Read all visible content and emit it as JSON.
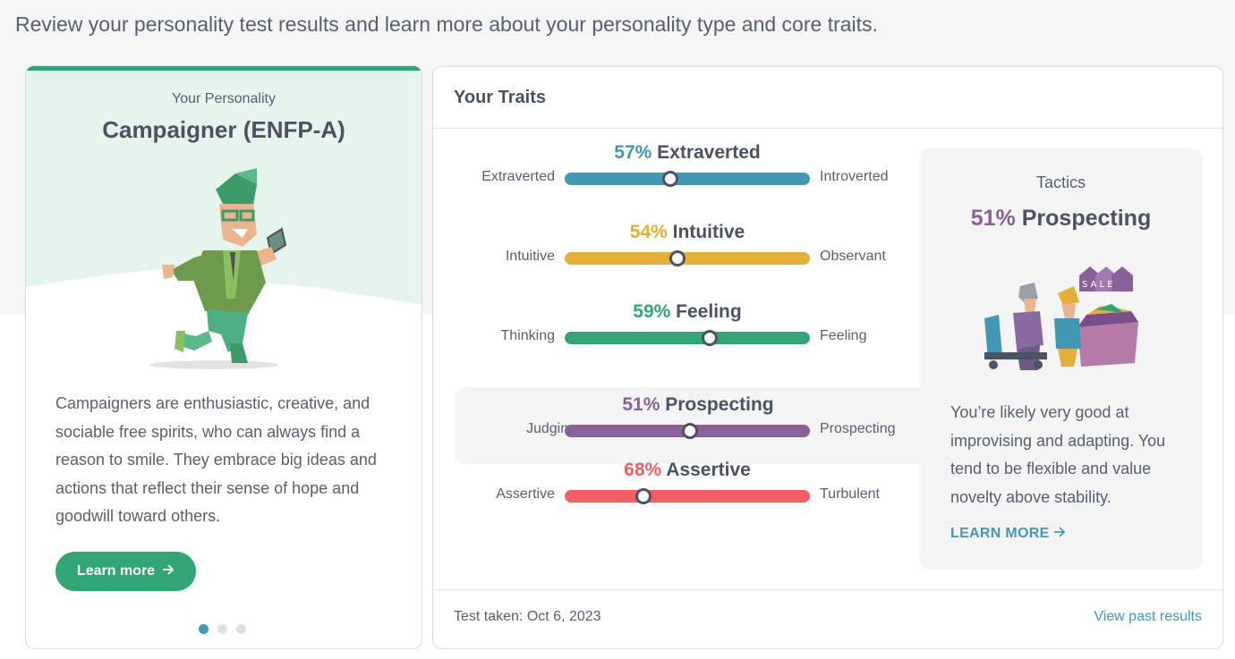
{
  "intro_text": "Review your personality test results and learn more about your personality type and core traits.",
  "personality_card": {
    "label": "Your Personality",
    "type_name": "Campaigner (ENFP-A)",
    "description": "Campaigners are enthusiastic, creative, and sociable free spirits, who can always find a reason to smile. They embrace big ideas and actions that reflect their sense of hope and goodwill toward others.",
    "button_label": "Learn more",
    "carousel": {
      "count": 3,
      "active": 0
    },
    "accent": "#33a474"
  },
  "traits_card": {
    "title": "Your Traits",
    "traits": [
      {
        "percent": "57%",
        "name": "Extraverted",
        "left": "Extraverted",
        "right": "Introverted",
        "position": 0.43,
        "color": "#4298b4",
        "highlighted": false
      },
      {
        "percent": "54%",
        "name": "Intuitive",
        "left": "Intuitive",
        "right": "Observant",
        "position": 0.46,
        "color": "#e4ae3a",
        "highlighted": false
      },
      {
        "percent": "59%",
        "name": "Feeling",
        "left": "Thinking",
        "right": "Feeling",
        "position": 0.59,
        "color": "#33a474",
        "highlighted": false
      },
      {
        "percent": "51%",
        "name": "Prospecting",
        "left": "Judging",
        "right": "Prospecting",
        "position": 0.51,
        "color": "#88619a",
        "highlighted": true
      },
      {
        "percent": "68%",
        "name": "Assertive",
        "left": "Assertive",
        "right": "Turbulent",
        "position": 0.32,
        "color": "#f25e62",
        "highlighted": false
      }
    ],
    "tactics": {
      "label": "Tactics",
      "percent": "51%",
      "name": "Prospecting",
      "description": "You’re likely very good at improvising and adapting. You tend to be flexible and value novelty above stability.",
      "learn_more": "LEARN MORE"
    },
    "footer": {
      "test_taken": "Test taken: Oct 6, 2023",
      "past_results": "View past results"
    }
  }
}
